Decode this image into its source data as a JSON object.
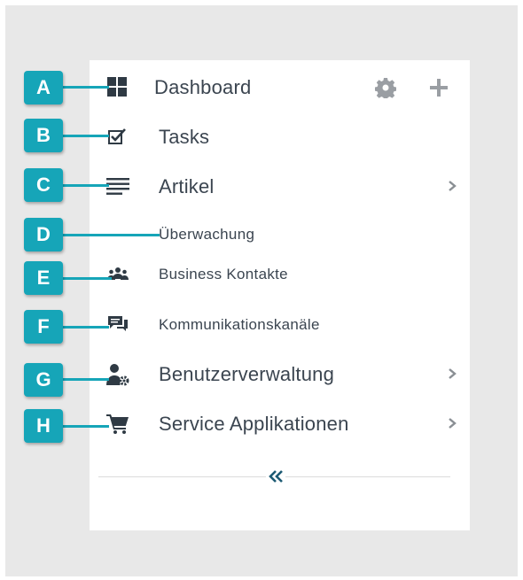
{
  "menu": {
    "items": [
      {
        "id": "A",
        "label": "Dashboard",
        "icon": "dashboard-icon"
      },
      {
        "id": "B",
        "label": "Tasks",
        "icon": "tasks-check-icon"
      },
      {
        "id": "C",
        "label": "Artikel",
        "icon": "list-lines-icon",
        "has_submenu": true
      },
      {
        "id": "D",
        "label": "Überwachung",
        "icon": ""
      },
      {
        "id": "E",
        "label": "Business Kontakte",
        "icon": "contacts-group-icon"
      },
      {
        "id": "F",
        "label": "Kommunikationskanäle",
        "icon": "chat-bubbles-icon"
      },
      {
        "id": "G",
        "label": "Benutzerverwaltung",
        "icon": "user-settings-icon",
        "has_submenu": true
      },
      {
        "id": "H",
        "label": "Service Applikationen",
        "icon": "cart-icon",
        "has_submenu": true
      }
    ],
    "tools": [
      {
        "name": "settings",
        "icon": "gear-icon"
      },
      {
        "name": "add",
        "icon": "plus-icon"
      }
    ],
    "collapse_icon": "double-chevron-left-icon"
  },
  "colors": {
    "callout": "#16a5b8",
    "text": "#3b4550",
    "icon": "#2f3a44",
    "collapse": "#1c5a73",
    "background": "#e8e8e8"
  }
}
